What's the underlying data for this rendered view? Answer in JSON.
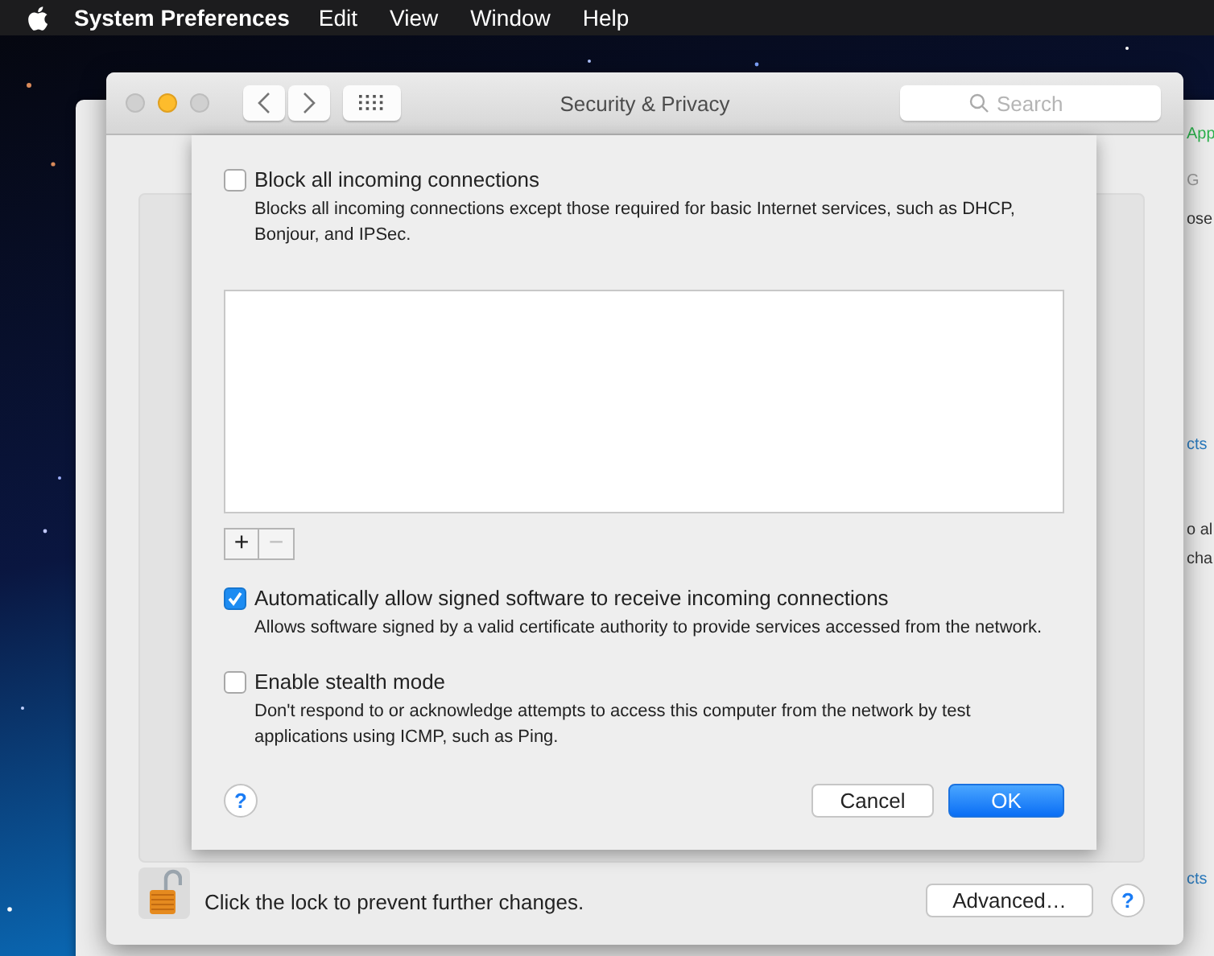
{
  "menu_bar": {
    "app_name": "System Preferences",
    "items": [
      "Edit",
      "View",
      "Window",
      "Help"
    ]
  },
  "background_window": {
    "fragments": [
      {
        "text": "App",
        "kind": "accent"
      },
      {
        "text": "G",
        "kind": "muted"
      },
      {
        "text": "ose",
        "kind": "plain"
      },
      {
        "text": "cts",
        "kind": "link"
      },
      {
        "text": "o al",
        "kind": "plain"
      },
      {
        "text": "cha",
        "kind": "plain"
      },
      {
        "text": "cts",
        "kind": "link"
      }
    ]
  },
  "window": {
    "title": "Security & Privacy",
    "traffic_lights": [
      {
        "lit": false
      },
      {
        "lit": true
      },
      {
        "lit": false
      }
    ],
    "search": {
      "placeholder": "Search"
    },
    "lock": {
      "unlocked": true,
      "text": "Click the lock to prevent further changes."
    },
    "advanced_button": "Advanced…",
    "help_button": "?"
  },
  "sheet": {
    "block_all": {
      "label": "Block all incoming connections",
      "description": "Blocks all incoming connections except those required for basic Internet services,  such as DHCP, Bonjour, and IPSec.",
      "checked": false
    },
    "app_list": {
      "add_button": {
        "label": "+",
        "disabled": false
      },
      "remove_button": {
        "label": "−",
        "disabled": true
      }
    },
    "options": [
      {
        "label": "Automatically allow signed software to receive incoming connections",
        "description": "Allows software signed by a valid certificate authority to provide services accessed from the network.",
        "checked": true
      },
      {
        "label": "Enable stealth mode",
        "description": "Don't respond to or acknowledge attempts to access this computer from the network by test applications using ICMP, such as Ping.",
        "checked": false
      }
    ],
    "help_button": "?",
    "buttons": [
      {
        "label": "Cancel",
        "default": false
      },
      {
        "label": "OK",
        "default": true
      }
    ]
  }
}
